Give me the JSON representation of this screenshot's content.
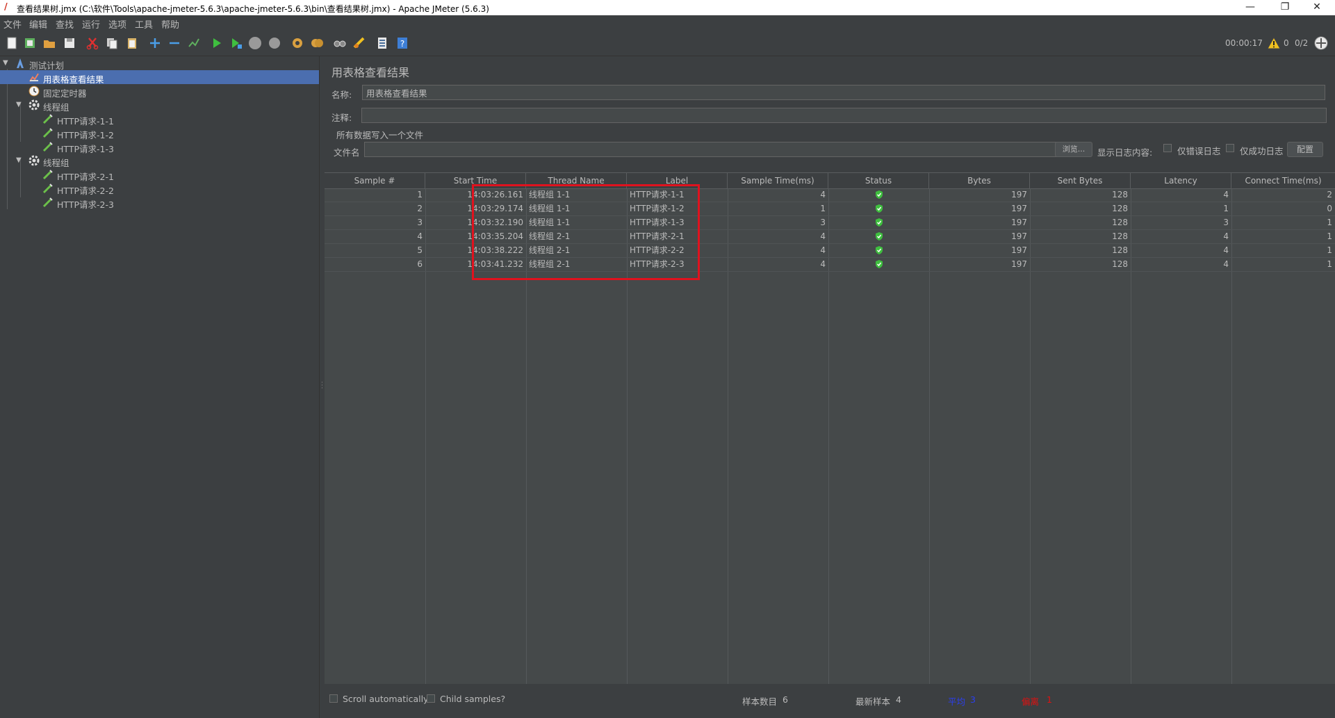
{
  "window": {
    "title": "查看结果树.jmx (C:\\软件\\Tools\\apache-jmeter-5.6.3\\apache-jmeter-5.6.3\\bin\\查看结果树.jmx) - Apache JMeter (5.6.3)",
    "minimize": "—",
    "restore": "❐",
    "close": "✕"
  },
  "menu": [
    "文件",
    "编辑",
    "查找",
    "运行",
    "选项",
    "工具",
    "帮助"
  ],
  "toolbar": {
    "elapsed": "00:00:17",
    "warnings": "0",
    "threads": "0/2",
    "icons": [
      "new-icon",
      "templates-icon",
      "open-icon",
      "save-icon",
      "cut-icon",
      "copy-icon",
      "paste-icon",
      "expand-icon",
      "collapse-icon",
      "toggle-icon",
      "start-icon",
      "start-no-pause-icon",
      "stop-icon",
      "shutdown-icon",
      "clear-icon",
      "clear-all-icon",
      "search-icon",
      "reset-search-icon",
      "function-helper-icon",
      "help-icon"
    ]
  },
  "tree": {
    "items": [
      {
        "label": "测试计划",
        "level": 0,
        "expanded": true,
        "icon": "test-plan-icon",
        "selected": false
      },
      {
        "label": "用表格查看结果",
        "level": 1,
        "icon": "table-results-icon",
        "selected": true
      },
      {
        "label": "固定定时器",
        "level": 1,
        "icon": "timer-icon",
        "selected": false
      },
      {
        "label": "线程组",
        "level": 1,
        "expanded": true,
        "icon": "thread-group-icon",
        "selected": false
      },
      {
        "label": "HTTP请求-1-1",
        "level": 2,
        "icon": "http-sampler-icon",
        "selected": false
      },
      {
        "label": "HTTP请求-1-2",
        "level": 2,
        "icon": "http-sampler-icon",
        "selected": false
      },
      {
        "label": "HTTP请求-1-3",
        "level": 2,
        "icon": "http-sampler-icon",
        "selected": false
      },
      {
        "label": "线程组",
        "level": 1,
        "expanded": true,
        "icon": "thread-group-icon",
        "selected": false
      },
      {
        "label": "HTTP请求-2-1",
        "level": 2,
        "icon": "http-sampler-icon",
        "selected": false
      },
      {
        "label": "HTTP请求-2-2",
        "level": 2,
        "icon": "http-sampler-icon",
        "selected": false
      },
      {
        "label": "HTTP请求-2-3",
        "level": 2,
        "icon": "http-sampler-icon",
        "selected": false
      }
    ]
  },
  "panel": {
    "title": "用表格查看结果",
    "name_label": "名称:",
    "name_value": "用表格查看结果",
    "comment_label": "注释:",
    "comment_value": "",
    "file_section": "所有数据写入一个文件",
    "filename_label": "文件名",
    "filename_value": "",
    "browse_button": "浏览...",
    "log_content_label": "显示日志内容:",
    "errors_only_label": "仅错误日志",
    "success_only_label": "仅成功日志",
    "configure_button": "配置"
  },
  "table": {
    "columns": [
      "Sample #",
      "Start Time",
      "Thread Name",
      "Label",
      "Sample Time(ms)",
      "Status",
      "Bytes",
      "Sent Bytes",
      "Latency",
      "Connect Time(ms)"
    ],
    "rows": [
      [
        "1",
        "14:03:26.161",
        "线程组 1-1",
        "HTTP请求-1-1",
        "4",
        "success",
        "197",
        "128",
        "4",
        "2"
      ],
      [
        "2",
        "14:03:29.174",
        "线程组 1-1",
        "HTTP请求-1-2",
        "1",
        "success",
        "197",
        "128",
        "1",
        "0"
      ],
      [
        "3",
        "14:03:32.190",
        "线程组 1-1",
        "HTTP请求-1-3",
        "3",
        "success",
        "197",
        "128",
        "3",
        "1"
      ],
      [
        "4",
        "14:03:35.204",
        "线程组 2-1",
        "HTTP请求-2-1",
        "4",
        "success",
        "197",
        "128",
        "4",
        "1"
      ],
      [
        "5",
        "14:03:38.222",
        "线程组 2-1",
        "HTTP请求-2-2",
        "4",
        "success",
        "197",
        "128",
        "4",
        "1"
      ],
      [
        "6",
        "14:03:41.232",
        "线程组 2-1",
        "HTTP请求-2-3",
        "4",
        "success",
        "197",
        "128",
        "4",
        "1"
      ]
    ]
  },
  "footer": {
    "scroll_auto_label": "Scroll automatically?",
    "child_samples_label": "Child samples?",
    "sample_count_label": "样本数目",
    "sample_count_value": "6",
    "latest_sample_label": "最新样本",
    "latest_sample_value": "4",
    "average_label": "平均",
    "average_value": "3",
    "deviation_label": "偏离",
    "deviation_value": "1"
  },
  "colors": {
    "background": "#3c3f41",
    "selection": "#4b6eaf",
    "highlight_box": "#e0121e",
    "average_text": "#2b3ff0",
    "deviation_text": "#e01010",
    "status_ok": "#3fbf3f"
  }
}
